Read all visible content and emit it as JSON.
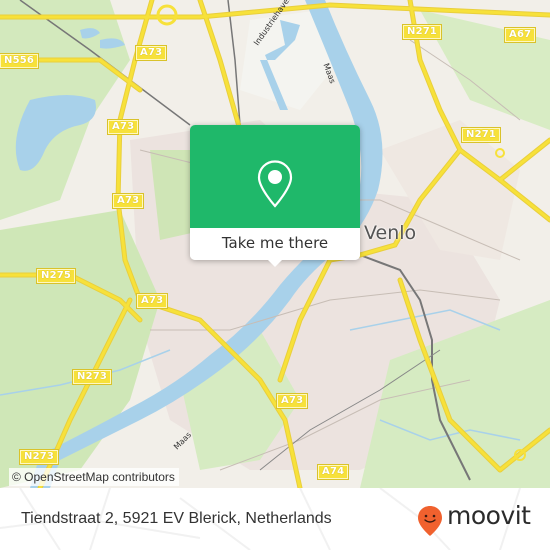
{
  "map": {
    "city_label": "Venlo",
    "water_labels": [
      "Industriehaven",
      "Maas",
      "Maas"
    ],
    "road_shields": [
      "A73",
      "A73",
      "A73",
      "A73",
      "A73",
      "N556",
      "N271",
      "N271",
      "A67",
      "N275",
      "N273",
      "N273",
      "A74"
    ],
    "attribution": "© OpenStreetMap contributors",
    "colors": {
      "land": "#f2efe9",
      "green": "#cde6b4",
      "water": "#a8d1ea",
      "motorway": "#f7e13a",
      "urban": "#ece3df"
    }
  },
  "popup": {
    "button_label": "Take me there",
    "icon": "map-pin-icon",
    "color": "#1fb86a"
  },
  "footer": {
    "address": "Tiendstraat 2, 5921 EV Blerick, Netherlands",
    "brand": "moovit",
    "brand_color": "#f0612e"
  }
}
